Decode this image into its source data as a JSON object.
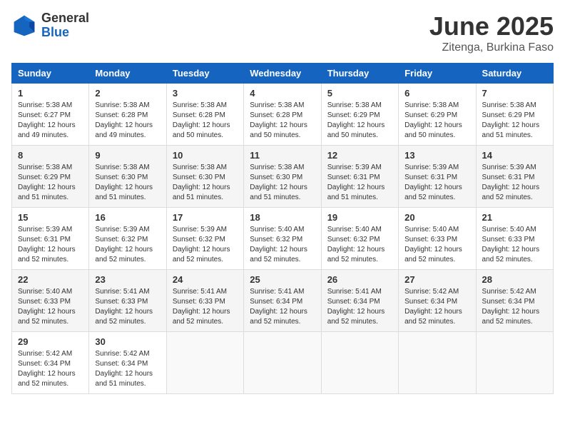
{
  "logo": {
    "general": "General",
    "blue": "Blue"
  },
  "title": "June 2025",
  "location": "Zitenga, Burkina Faso",
  "days_header": [
    "Sunday",
    "Monday",
    "Tuesday",
    "Wednesday",
    "Thursday",
    "Friday",
    "Saturday"
  ],
  "weeks": [
    [
      {
        "day": "1",
        "info": "Sunrise: 5:38 AM\nSunset: 6:27 PM\nDaylight: 12 hours\nand 49 minutes."
      },
      {
        "day": "2",
        "info": "Sunrise: 5:38 AM\nSunset: 6:28 PM\nDaylight: 12 hours\nand 49 minutes."
      },
      {
        "day": "3",
        "info": "Sunrise: 5:38 AM\nSunset: 6:28 PM\nDaylight: 12 hours\nand 50 minutes."
      },
      {
        "day": "4",
        "info": "Sunrise: 5:38 AM\nSunset: 6:28 PM\nDaylight: 12 hours\nand 50 minutes."
      },
      {
        "day": "5",
        "info": "Sunrise: 5:38 AM\nSunset: 6:29 PM\nDaylight: 12 hours\nand 50 minutes."
      },
      {
        "day": "6",
        "info": "Sunrise: 5:38 AM\nSunset: 6:29 PM\nDaylight: 12 hours\nand 50 minutes."
      },
      {
        "day": "7",
        "info": "Sunrise: 5:38 AM\nSunset: 6:29 PM\nDaylight: 12 hours\nand 51 minutes."
      }
    ],
    [
      {
        "day": "8",
        "info": "Sunrise: 5:38 AM\nSunset: 6:29 PM\nDaylight: 12 hours\nand 51 minutes."
      },
      {
        "day": "9",
        "info": "Sunrise: 5:38 AM\nSunset: 6:30 PM\nDaylight: 12 hours\nand 51 minutes."
      },
      {
        "day": "10",
        "info": "Sunrise: 5:38 AM\nSunset: 6:30 PM\nDaylight: 12 hours\nand 51 minutes."
      },
      {
        "day": "11",
        "info": "Sunrise: 5:38 AM\nSunset: 6:30 PM\nDaylight: 12 hours\nand 51 minutes."
      },
      {
        "day": "12",
        "info": "Sunrise: 5:39 AM\nSunset: 6:31 PM\nDaylight: 12 hours\nand 51 minutes."
      },
      {
        "day": "13",
        "info": "Sunrise: 5:39 AM\nSunset: 6:31 PM\nDaylight: 12 hours\nand 52 minutes."
      },
      {
        "day": "14",
        "info": "Sunrise: 5:39 AM\nSunset: 6:31 PM\nDaylight: 12 hours\nand 52 minutes."
      }
    ],
    [
      {
        "day": "15",
        "info": "Sunrise: 5:39 AM\nSunset: 6:31 PM\nDaylight: 12 hours\nand 52 minutes."
      },
      {
        "day": "16",
        "info": "Sunrise: 5:39 AM\nSunset: 6:32 PM\nDaylight: 12 hours\nand 52 minutes."
      },
      {
        "day": "17",
        "info": "Sunrise: 5:39 AM\nSunset: 6:32 PM\nDaylight: 12 hours\nand 52 minutes."
      },
      {
        "day": "18",
        "info": "Sunrise: 5:40 AM\nSunset: 6:32 PM\nDaylight: 12 hours\nand 52 minutes."
      },
      {
        "day": "19",
        "info": "Sunrise: 5:40 AM\nSunset: 6:32 PM\nDaylight: 12 hours\nand 52 minutes."
      },
      {
        "day": "20",
        "info": "Sunrise: 5:40 AM\nSunset: 6:33 PM\nDaylight: 12 hours\nand 52 minutes."
      },
      {
        "day": "21",
        "info": "Sunrise: 5:40 AM\nSunset: 6:33 PM\nDaylight: 12 hours\nand 52 minutes."
      }
    ],
    [
      {
        "day": "22",
        "info": "Sunrise: 5:40 AM\nSunset: 6:33 PM\nDaylight: 12 hours\nand 52 minutes."
      },
      {
        "day": "23",
        "info": "Sunrise: 5:41 AM\nSunset: 6:33 PM\nDaylight: 12 hours\nand 52 minutes."
      },
      {
        "day": "24",
        "info": "Sunrise: 5:41 AM\nSunset: 6:33 PM\nDaylight: 12 hours\nand 52 minutes."
      },
      {
        "day": "25",
        "info": "Sunrise: 5:41 AM\nSunset: 6:34 PM\nDaylight: 12 hours\nand 52 minutes."
      },
      {
        "day": "26",
        "info": "Sunrise: 5:41 AM\nSunset: 6:34 PM\nDaylight: 12 hours\nand 52 minutes."
      },
      {
        "day": "27",
        "info": "Sunrise: 5:42 AM\nSunset: 6:34 PM\nDaylight: 12 hours\nand 52 minutes."
      },
      {
        "day": "28",
        "info": "Sunrise: 5:42 AM\nSunset: 6:34 PM\nDaylight: 12 hours\nand 52 minutes."
      }
    ],
    [
      {
        "day": "29",
        "info": "Sunrise: 5:42 AM\nSunset: 6:34 PM\nDaylight: 12 hours\nand 52 minutes."
      },
      {
        "day": "30",
        "info": "Sunrise: 5:42 AM\nSunset: 6:34 PM\nDaylight: 12 hours\nand 51 minutes."
      },
      {
        "day": "",
        "info": ""
      },
      {
        "day": "",
        "info": ""
      },
      {
        "day": "",
        "info": ""
      },
      {
        "day": "",
        "info": ""
      },
      {
        "day": "",
        "info": ""
      }
    ]
  ]
}
